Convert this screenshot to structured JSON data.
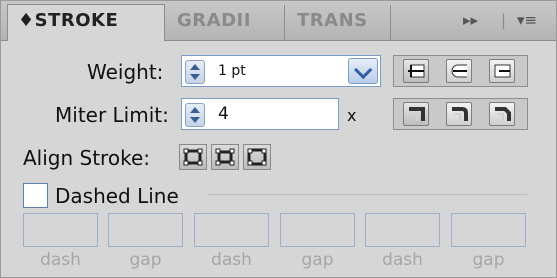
{
  "tabs": [
    {
      "label": "STROKE",
      "prefix": "♦",
      "active": true
    },
    {
      "label": "GRADII",
      "active": false
    },
    {
      "label": "TRANS",
      "active": false
    }
  ],
  "tab_controls": {
    "expand": "▸▸",
    "separator": "|",
    "menu": "▾≡"
  },
  "weight": {
    "label": "Weight:",
    "value": "1 pt"
  },
  "miter_limit": {
    "label": "Miter Limit:",
    "value": "4",
    "suffix": "x"
  },
  "align_stroke": {
    "label": "Align Stroke:"
  },
  "dashed_line": {
    "label": "Dashed Line",
    "checked": false
  },
  "dash_fields": [
    {
      "label": "dash",
      "value": ""
    },
    {
      "label": "gap",
      "value": ""
    },
    {
      "label": "dash",
      "value": ""
    },
    {
      "label": "gap",
      "value": ""
    },
    {
      "label": "dash",
      "value": ""
    },
    {
      "label": "gap",
      "value": ""
    }
  ],
  "icons": {
    "cap_buttons": [
      "butt-cap-icon",
      "round-cap-icon",
      "projecting-cap-icon"
    ],
    "join_buttons": [
      "miter-join-icon",
      "round-join-icon",
      "bevel-join-icon"
    ],
    "align_buttons": [
      "align-center-icon",
      "align-inside-icon",
      "align-outside-icon"
    ]
  },
  "colors": {
    "panel_bg": "#d6d6d6",
    "field_border": "#7a9cc8",
    "accent": "#2f5fa6"
  }
}
